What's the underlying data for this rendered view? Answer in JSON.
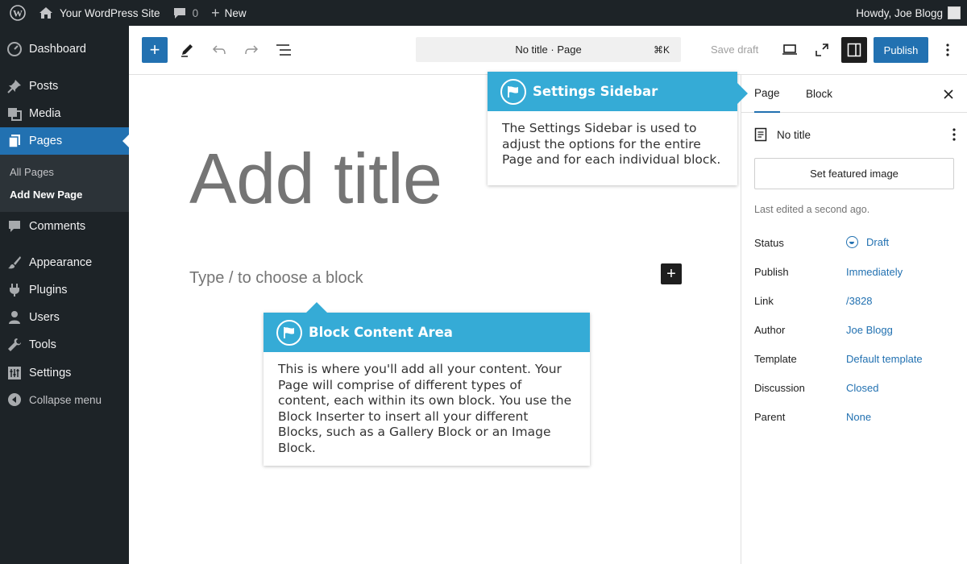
{
  "adminbar": {
    "site_name": "Your WordPress Site",
    "comments_count": "0",
    "new_label": "New",
    "greeting": "Howdy, Joe Blogg"
  },
  "menu": {
    "items": [
      {
        "label": "Dashboard",
        "icon": "dashboard-icon"
      },
      {
        "label": "Posts",
        "icon": "pin-icon"
      },
      {
        "label": "Media",
        "icon": "media-icon"
      },
      {
        "label": "Pages",
        "icon": "pages-icon"
      },
      {
        "label": "Comments",
        "icon": "comment-icon"
      },
      {
        "label": "Appearance",
        "icon": "brush-icon"
      },
      {
        "label": "Plugins",
        "icon": "plug-icon"
      },
      {
        "label": "Users",
        "icon": "user-icon"
      },
      {
        "label": "Tools",
        "icon": "wrench-icon"
      },
      {
        "label": "Settings",
        "icon": "sliders-icon"
      }
    ],
    "submenu": [
      "All Pages",
      "Add New Page"
    ],
    "collapse_label": "Collapse menu"
  },
  "toolbar": {
    "document_title": "No title · Page",
    "shortcut": "⌘K",
    "save_draft": "Save draft",
    "publish": "Publish"
  },
  "canvas": {
    "title_placeholder": "Add title",
    "block_placeholder": "Type / to choose a block"
  },
  "sidebar": {
    "tabs": [
      "Page",
      "Block"
    ],
    "doc_title": "No title",
    "featured_image_button": "Set featured image",
    "last_edited": "Last edited a second ago.",
    "meta": [
      {
        "label": "Status",
        "value": "Draft"
      },
      {
        "label": "Publish",
        "value": "Immediately"
      },
      {
        "label": "Link",
        "value": "/3828"
      },
      {
        "label": "Author",
        "value": "Joe Blogg"
      },
      {
        "label": "Template",
        "value": "Default template"
      },
      {
        "label": "Discussion",
        "value": "Closed"
      },
      {
        "label": "Parent",
        "value": "None"
      }
    ]
  },
  "callouts": {
    "settings": {
      "title": "Settings Sidebar",
      "body": "The Settings Sidebar is used to adjust the options for the entire Page and for each individual block."
    },
    "block": {
      "title": "Block Content Area",
      "body": "This is where you'll add all your content. Your Page will comprise of different types of content, each within its own block. You use the Block Inserter to insert all your different Blocks, such as a Gallery Block or an Image Block."
    }
  },
  "colors": {
    "admin_dark": "#1d2327",
    "accent_blue": "#2271b1",
    "callout_blue": "#35abd6"
  }
}
